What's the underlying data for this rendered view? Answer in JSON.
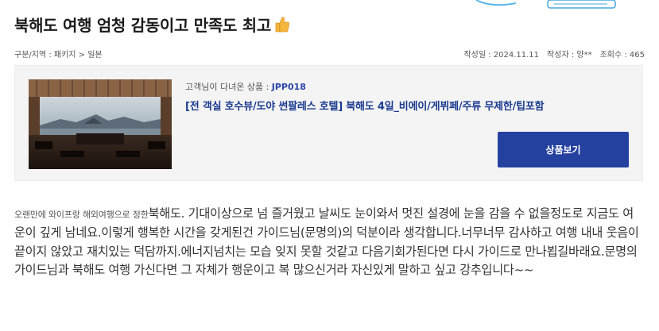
{
  "post": {
    "title": "북해도 여행 엄청 감동이고 만족도 최고",
    "emoji": "thumbs-up-icon"
  },
  "meta": {
    "breadcrumb": "구분/지역 : 패키지 > 일본",
    "date_label": "작성일 : 2024.11.11",
    "author_label": "작성자 : 양**",
    "views_label": "조회수 : 465"
  },
  "product": {
    "tag_prefix": "고객님이 다녀온 상품 : ",
    "code": "JPP018",
    "name": "[전 객실 호수뷰/도야 썬팔레스 호텔] 북해도 4일_비에이/게뷔페/주류 무제한/팁포함",
    "button_label": "상품보기"
  },
  "review": {
    "lead": "오랜만에 와이프랑 해외여행으로 정한",
    "body": "북해도. 기대이상으로 넘 즐거웠고 날씨도 눈이와서 멋진 설경에 눈을 감을 수 없을정도로 지금도 여운이 깊게 남네요.이렇게 행복한 시간을 갖게된건 가이드님(문명의)의 덕분이라 생각합니다.너무너무 감사하고 여행 내내 웃음이 끝이지 않았고 재치있는 덕담까지.에너지넘치는 모습 잊지 못할 것같고 다음기회가된다면 다시 가이드로 만나뵙길바래요.문명의 가이드님과 북해도 여행 가신다면 그 자체가 행운이고 복 많으신거라 자신있게 말하고 싶고 강추입니다~~"
  },
  "colors": {
    "accent": "#2541a0",
    "product_name": "#1a3a8f",
    "card_bg": "#f4f4f4"
  }
}
